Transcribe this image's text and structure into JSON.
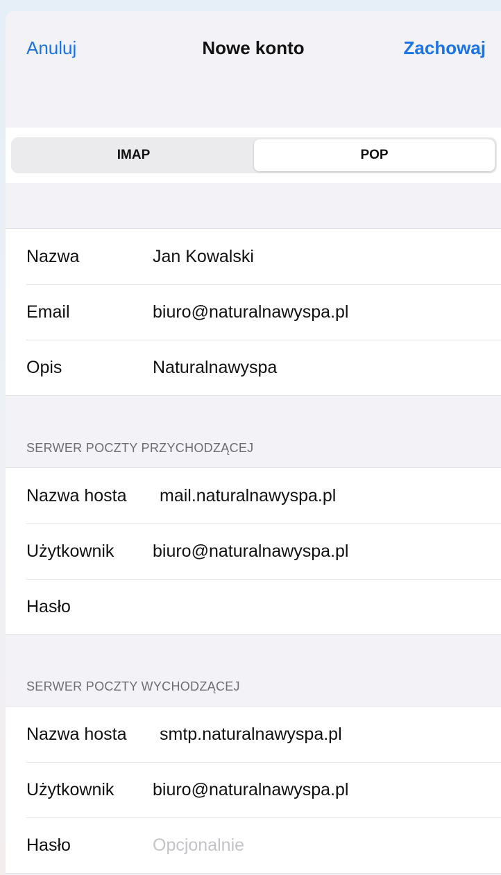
{
  "nav": {
    "cancel_label": "Anuluj",
    "title": "Nowe konto",
    "save_label": "Zachowaj"
  },
  "segmented": {
    "options": [
      "IMAP",
      "POP"
    ],
    "selected": "POP"
  },
  "account": {
    "name_label": "Nazwa",
    "name_value": "Jan Kowalski",
    "email_label": "Email",
    "email_value": "biuro@naturalnawyspa.pl",
    "desc_label": "Opis",
    "desc_value": "Naturalnawyspa"
  },
  "incoming": {
    "header": "SERWER POCZTY PRZYCHODZĄCEJ",
    "host_label": "Nazwa hosta",
    "host_value": "mail.naturalnawyspa.pl",
    "user_label": "Użytkownik",
    "user_value": "biuro@naturalnawyspa.pl",
    "password_label": "Hasło",
    "password_value": ""
  },
  "outgoing": {
    "header": "SERWER POCZTY WYCHODZĄCEJ",
    "host_label": "Nazwa hosta",
    "host_value": "smtp.naturalnawyspa.pl",
    "user_label": "Użytkownik",
    "user_value": "biuro@naturalnawyspa.pl",
    "password_label": "Hasło",
    "password_placeholder": "Opcjonalnie"
  },
  "colors": {
    "accent": "#1a73e8",
    "grouped_background": "#f2f2f7",
    "cell_background": "#ffffff",
    "secondary_text": "#6d6d72",
    "placeholder_text": "#c4c4c8"
  }
}
